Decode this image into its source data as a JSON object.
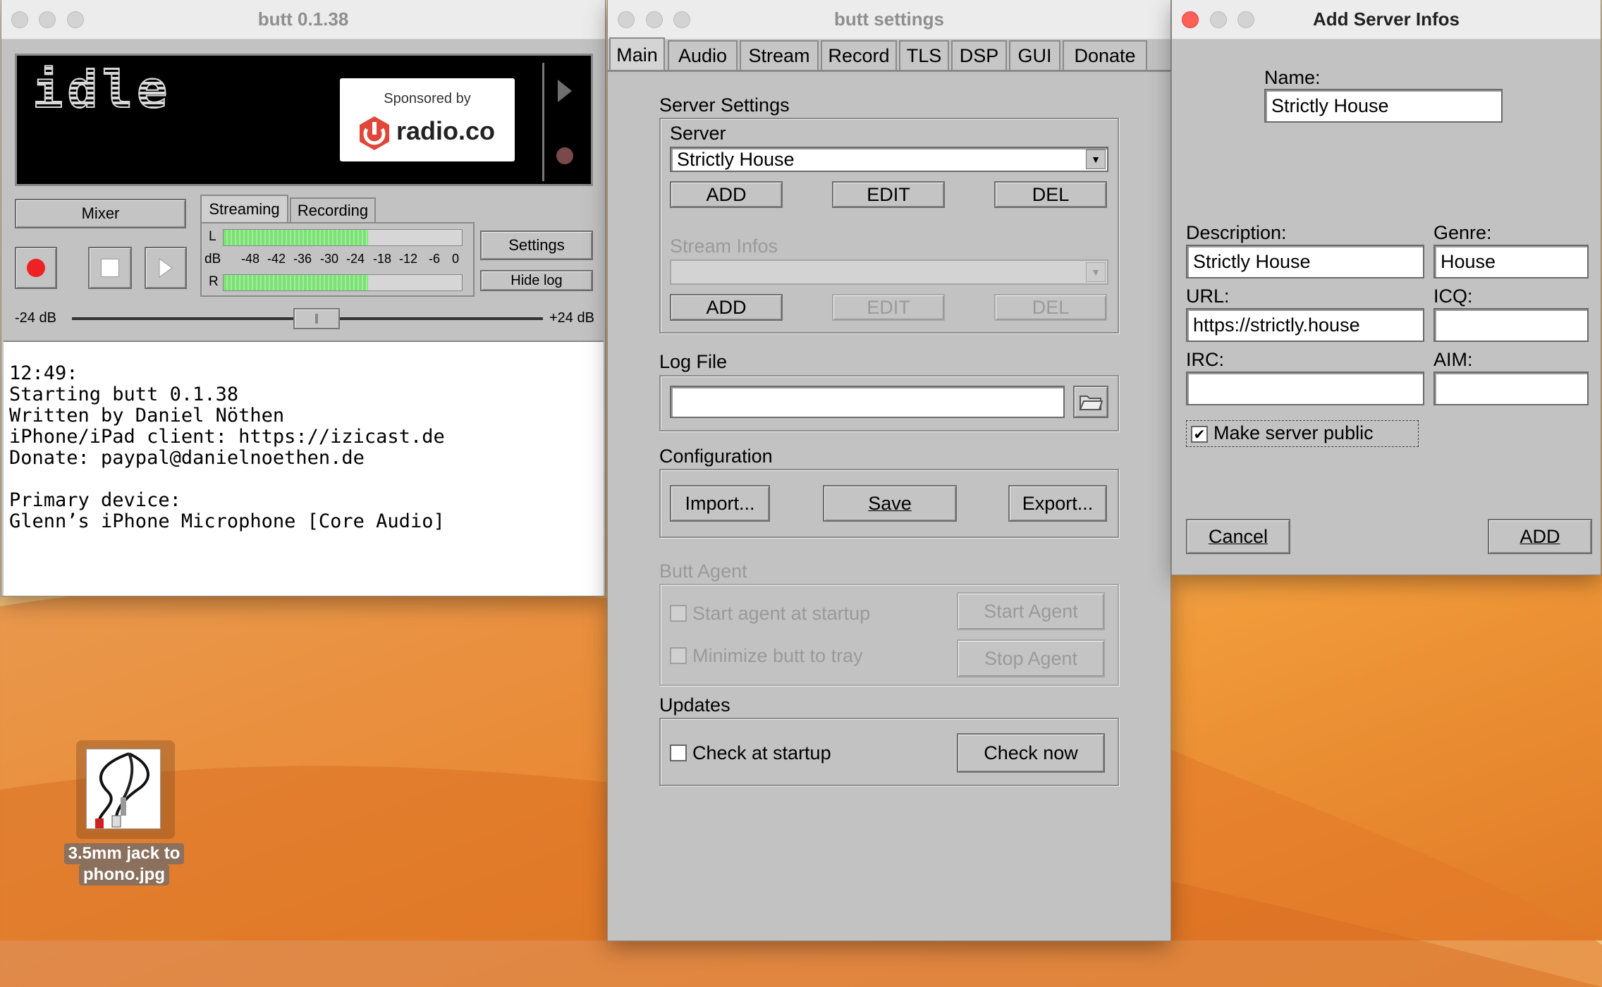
{
  "main_window": {
    "title": "butt 0.1.38",
    "display_status": "idle",
    "sponsor_line": "Sponsored by",
    "sponsor_brand": "radio.co",
    "mixer_label": "Mixer",
    "tab_streaming": "Streaming",
    "tab_recording": "Recording",
    "vu_l": "L",
    "vu_db": "dB",
    "vu_r": "R",
    "vu_scale": [
      "-48",
      "-42",
      "-36",
      "-30",
      "-24",
      "-18",
      "-12",
      "-6",
      "0"
    ],
    "settings_label": "Settings",
    "hide_log_label": "Hide log",
    "gain_min": "-24 dB",
    "gain_max": "+24 dB",
    "gain_level": 0.52,
    "log_lines": [
      "12:49:",
      "Starting butt 0.1.38",
      "Written by Daniel Nöthen",
      "iPhone/iPad client: https://izicast.de",
      "Donate: paypal@danielnoethen.de",
      "",
      "Primary device:",
      "Glenn’s iPhone Microphone [Core Audio]"
    ]
  },
  "settings_window": {
    "title": "butt settings",
    "tabs": [
      "Main",
      "Audio",
      "Stream",
      "Record",
      "TLS",
      "DSP",
      "GUI",
      "Donate"
    ],
    "server_settings_title": "Server Settings",
    "server_label": "Server",
    "server_value": "Strictly House",
    "add_label": "ADD",
    "edit_label": "EDIT",
    "del_label": "DEL",
    "stream_infos_label": "Stream Infos",
    "log_file_title": "Log File",
    "log_file_value": "",
    "configuration_title": "Configuration",
    "import_label": "Import...",
    "save_label": "Save",
    "export_label": "Export...",
    "butt_agent_title": "Butt Agent",
    "start_agent_startup": "Start agent at startup",
    "minimize_tray": "Minimize butt to tray",
    "start_agent_label": "Start Agent",
    "stop_agent_label": "Stop Agent",
    "updates_title": "Updates",
    "check_startup_label": "Check at startup",
    "check_now_label": "Check now"
  },
  "add_server_window": {
    "title": "Add Server Infos",
    "name_label": "Name:",
    "name_value": "Strictly House",
    "description_label": "Description:",
    "description_value": "Strictly House",
    "genre_label": "Genre:",
    "genre_value": "House",
    "url_label": "URL:",
    "url_value": "https://strictly.house",
    "icq_label": "ICQ:",
    "icq_value": "",
    "irc_label": "IRC:",
    "irc_value": "",
    "aim_label": "AIM:",
    "aim_value": "",
    "public_label": "Make server public",
    "public_checked": true,
    "cancel_label": "Cancel",
    "add_label": "ADD"
  },
  "desktop": {
    "file_label_line1": "3.5mm jack to",
    "file_label_line2": "phono.jpg"
  }
}
